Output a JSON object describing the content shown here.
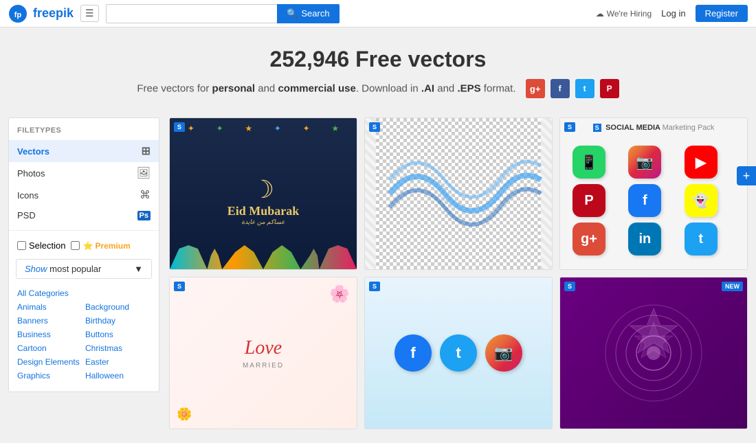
{
  "header": {
    "logo_text": "freepik",
    "menu_icon": "☰",
    "search_placeholder": "",
    "search_button": "Search",
    "hiring_text": "We're Hiring",
    "login_text": "Log in",
    "register_text": "Register"
  },
  "hero": {
    "title": "252,946 Free vectors",
    "subtitle_pre": "Free vectors for ",
    "subtitle_bold1": "personal",
    "subtitle_and": " and ",
    "subtitle_bold2": "commercial use",
    "subtitle_post": ". Download in ",
    "subtitle_bold3": ".AI",
    "subtitle_and2": " and ",
    "subtitle_bold4": ".EPS",
    "subtitle_format": " format.",
    "social": {
      "gplus": "g+",
      "facebook": "f",
      "twitter": "t",
      "pinterest": "P"
    }
  },
  "sidebar": {
    "filetypes_label": "FILETYPES",
    "items": [
      {
        "label": "Vectors",
        "icon": "⊞",
        "active": true
      },
      {
        "label": "Photos",
        "icon": "🖼",
        "active": false
      },
      {
        "label": "Icons",
        "icon": "⌘",
        "active": false
      },
      {
        "label": "PSD",
        "icon": "Ps",
        "active": false
      }
    ],
    "selection_label": "Selection",
    "premium_label": "Premium",
    "premium_icon": "⭐",
    "show_popular_label": "most popular",
    "show_text": "Show",
    "dropdown_icon": "▼",
    "categories": [
      {
        "col": 0,
        "label": "All Categories"
      },
      {
        "col": 0,
        "label": "Animals"
      },
      {
        "col": 1,
        "label": "Background"
      },
      {
        "col": 0,
        "label": "Banners"
      },
      {
        "col": 1,
        "label": "Birthday"
      },
      {
        "col": 0,
        "label": "Business"
      },
      {
        "col": 1,
        "label": "Buttons"
      },
      {
        "col": 0,
        "label": "Cartoon"
      },
      {
        "col": 1,
        "label": "Christmas"
      },
      {
        "col": 0,
        "label": "Design Elements"
      },
      {
        "col": 1,
        "label": "Easter"
      },
      {
        "col": 0,
        "label": "Graphics"
      },
      {
        "col": 1,
        "label": "Halloween"
      }
    ]
  },
  "images": [
    {
      "id": "eid",
      "badge": "S",
      "title": "Eid Mubarak",
      "type": "dark-eid"
    },
    {
      "id": "wave",
      "badge": "S",
      "title": "Blue Wave",
      "type": "wave"
    },
    {
      "id": "social",
      "badge": "S",
      "title": "Social Media Marketing Pack",
      "type": "social"
    },
    {
      "id": "love",
      "badge": "S",
      "title": "Love Married",
      "type": "love"
    },
    {
      "id": "fb-social",
      "badge": "S",
      "title": "Facebook Social Icons",
      "type": "fb"
    },
    {
      "id": "purple",
      "badge": "S",
      "badge_new": "NEW",
      "title": "Purple Pattern",
      "type": "purple"
    }
  ],
  "float": {
    "add_icon": "+"
  }
}
